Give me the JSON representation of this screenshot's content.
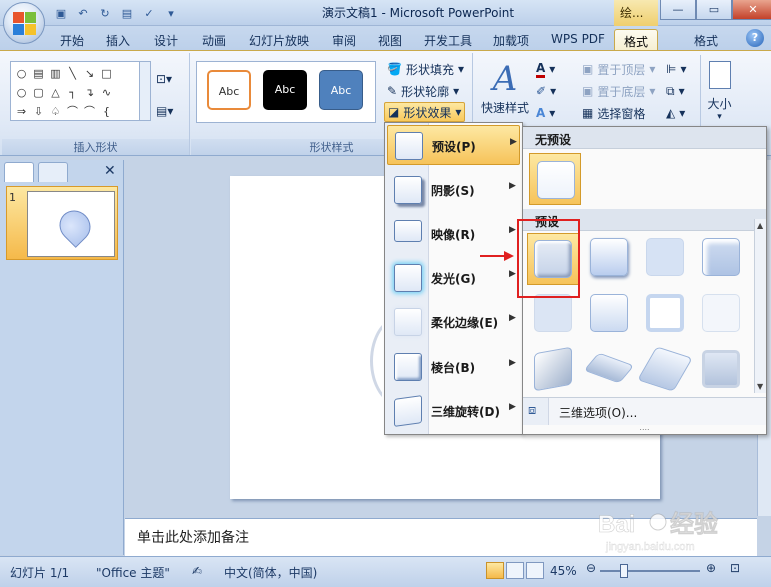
{
  "titlebar": {
    "title": "演示文稿1 - Microsoft PowerPoint",
    "tool_tab": "绘...",
    "quick_access": [
      "save-icon",
      "undo-icon",
      "redo-icon",
      "print-preview-icon",
      "spelling-icon",
      "dropdown-icon"
    ]
  },
  "tabs": [
    {
      "label": "开始"
    },
    {
      "label": "插入"
    },
    {
      "label": "设计"
    },
    {
      "label": "动画"
    },
    {
      "label": "幻灯片放映"
    },
    {
      "label": "审阅"
    },
    {
      "label": "视图"
    },
    {
      "label": "开发工具"
    },
    {
      "label": "加载项"
    },
    {
      "label": "WPS PDF"
    },
    {
      "label": "格式",
      "active": true
    },
    {
      "label": "格式"
    }
  ],
  "ribbon": {
    "insert_shapes_label": "插入形状",
    "shape_styles_label": "形状样式",
    "style_samples": [
      "Abc",
      "Abc",
      "Abc"
    ],
    "shape_fill": "形状填充",
    "shape_outline": "形状轮廓",
    "shape_effects": "形状效果",
    "quick_style": "快速样式",
    "bring_front": "置于顶层",
    "send_back": "置于底层",
    "selection_pane": "选择窗格",
    "size": "大小"
  },
  "effects_menu": [
    {
      "label": "预设(P)",
      "active": true
    },
    {
      "label": "阴影(S)"
    },
    {
      "label": "映像(R)"
    },
    {
      "label": "发光(G)"
    },
    {
      "label": "柔化边缘(E)"
    },
    {
      "label": "棱台(B)"
    },
    {
      "label": "三维旋转(D)"
    }
  ],
  "preset_gallery": {
    "no_preset_header": "无预设",
    "preset_header": "预设",
    "three_d_options": "三维选项(O)..."
  },
  "left_panel": {
    "slide_number": "1"
  },
  "notes_placeholder": "单击此处添加备注",
  "status": {
    "slide": "幻灯片 1/1",
    "theme": "\"Office 主题\"",
    "language": "中文(简体，中国)",
    "zoom": "45%"
  },
  "colors": {
    "accent_orange": "#f6c35a",
    "annotation_red": "#e02020",
    "ribbon_blue": "#c5d3e6"
  }
}
